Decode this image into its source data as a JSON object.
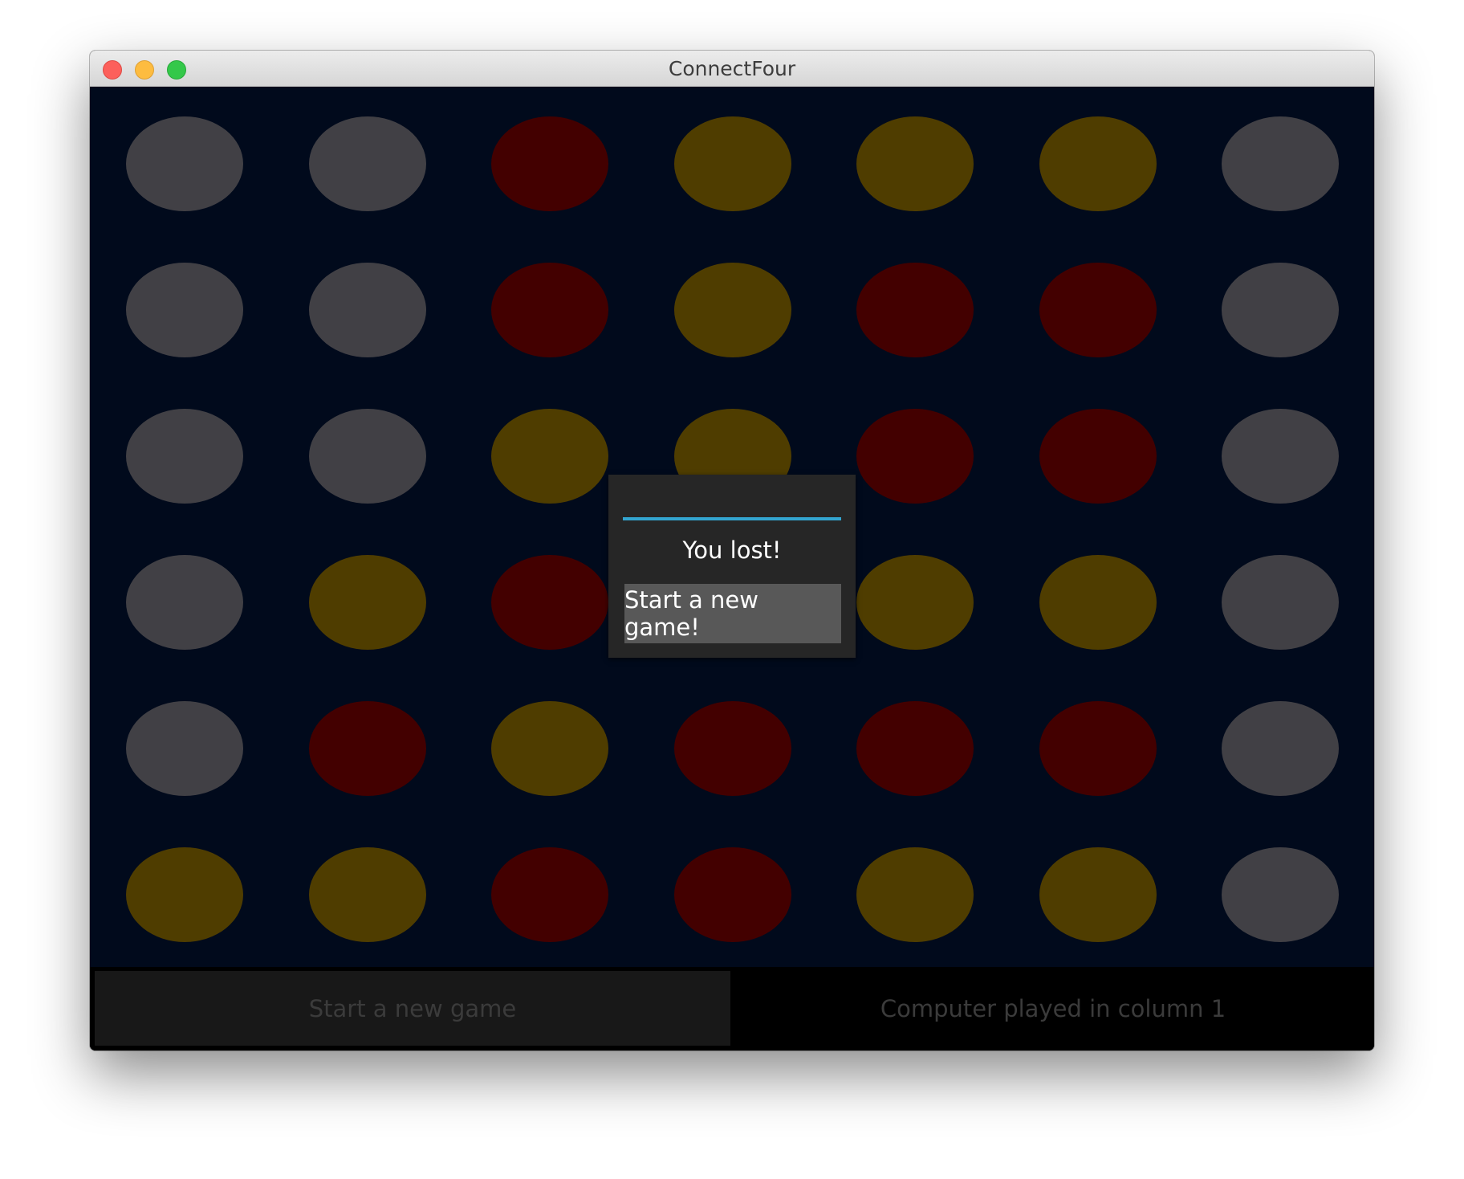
{
  "window": {
    "title": "ConnectFour"
  },
  "board": {
    "rows": 6,
    "columns": 7,
    "colors": {
      "empty": "#414045",
      "red": "#430000",
      "yellow": "#4f3d00",
      "background": "#010a1c"
    },
    "cells": [
      [
        "empty",
        "empty",
        "red",
        "yellow",
        "yellow",
        "yellow",
        "empty"
      ],
      [
        "empty",
        "empty",
        "red",
        "yellow",
        "red",
        "red",
        "empty"
      ],
      [
        "empty",
        "empty",
        "yellow",
        "yellow",
        "red",
        "red",
        "empty"
      ],
      [
        "empty",
        "yellow",
        "red",
        "yellow",
        "yellow",
        "yellow",
        "empty"
      ],
      [
        "empty",
        "red",
        "yellow",
        "red",
        "red",
        "red",
        "empty"
      ],
      [
        "yellow",
        "yellow",
        "red",
        "red",
        "yellow",
        "yellow",
        "empty"
      ]
    ]
  },
  "bottom_bar": {
    "new_game_label": "Start a new game",
    "status_text": "Computer played in column 1"
  },
  "dialog": {
    "message": "You lost!",
    "button_label": "Start a new game!",
    "accent_color": "#33a5d0"
  }
}
